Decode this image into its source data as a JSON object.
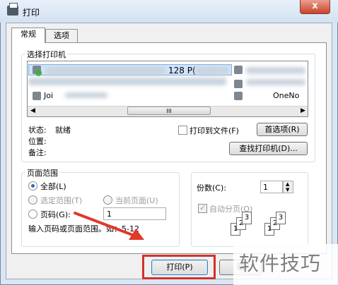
{
  "window": {
    "title": "打印",
    "close_glyph": "x"
  },
  "tabs": [
    {
      "label": "常规"
    },
    {
      "label": "选项"
    }
  ],
  "printer_group": {
    "label": "选择打印机",
    "printers": [
      {
        "name": "128 P("
      },
      {
        "name": "Joi"
      },
      {
        "name": "OneNo"
      }
    ],
    "scroll_glyph": "III",
    "status_label": "状态:",
    "status_value": "就绪",
    "location_label": "位置:",
    "comment_label": "备注:",
    "print_to_file_label": "打印到文件(F)",
    "preferences_button": "首选项(R)",
    "find_printer_button": "查找打印机(D)..."
  },
  "page_range": {
    "label": "页面范围",
    "all_label": "全部(L)",
    "selection_label": "选定范围(T)",
    "current_page_label": "当前页面(U)",
    "pages_label": "页码(G):",
    "pages_value": "1",
    "hint": "输入页码或页面范围。如：5-12"
  },
  "copies": {
    "label": "份数(C):",
    "value": "1",
    "collate_label": "自动分页(O)",
    "sheet_numbers": [
      "1",
      "2",
      "3"
    ]
  },
  "buttons": {
    "print": "打印(P)",
    "cancel": "取"
  },
  "watermark": "软件技巧",
  "colors": {
    "highlight": "#d3312c",
    "arrow": "#e0392a",
    "title_close": "#c7432b"
  }
}
